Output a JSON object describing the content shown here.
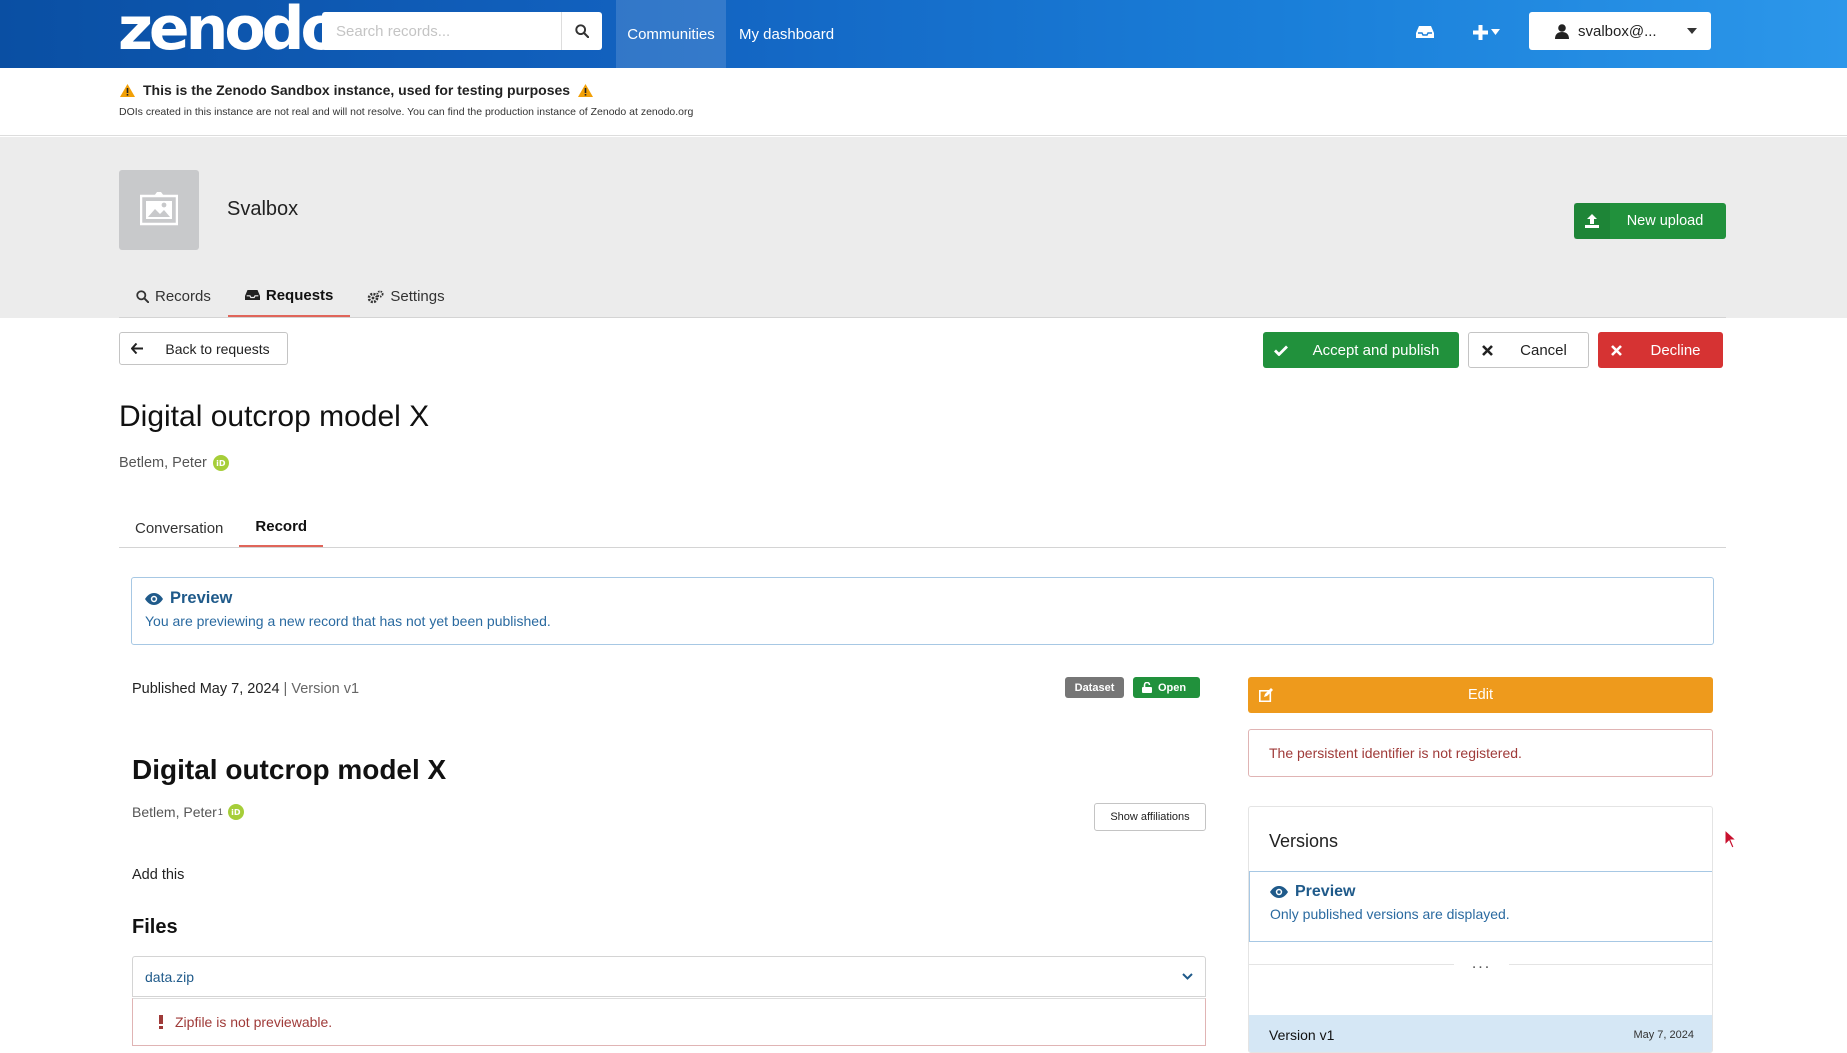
{
  "header": {
    "logo_text": "zenodo",
    "search_placeholder": "Search records...",
    "nav": [
      "Communities",
      "My dashboard"
    ],
    "user_label": "svalbox@...",
    "icons": [
      "search-icon",
      "inbox-icon",
      "plus-icon",
      "caret-down-icon",
      "user-icon"
    ]
  },
  "sandbox": {
    "title": "This is the Zenodo Sandbox instance, used for testing purposes",
    "subtitle": "DOIs created in this instance are not real and will not resolve. You can find the production instance of Zenodo at zenodo.org"
  },
  "community": {
    "name": "Svalbox",
    "new_upload_label": "New upload",
    "tabs": [
      {
        "label": "Records",
        "icon": "search-icon"
      },
      {
        "label": "Requests",
        "icon": "inbox-icon",
        "active": true
      },
      {
        "label": "Settings",
        "icon": "cogs-icon"
      }
    ]
  },
  "actions": {
    "back_label": "Back to requests",
    "accept_label": "Accept and publish",
    "cancel_label": "Cancel",
    "decline_label": "Decline"
  },
  "request": {
    "title": "Digital outcrop model X",
    "author": "Betlem, Peter",
    "tabs": [
      "Conversation",
      "Record"
    ],
    "active_tab": "Record"
  },
  "preview": {
    "heading": "Preview",
    "text": "You are previewing a new record that has not yet been published."
  },
  "record": {
    "published_label": "Published May 7, 2024",
    "version_label": "| Version v1",
    "badge_type": "Dataset",
    "badge_access": "Open",
    "title": "Digital outcrop model X",
    "author": "Betlem, Peter",
    "author_affiliation_marker": "1",
    "show_affiliations_label": "Show affiliations",
    "description": "Add this",
    "files_heading": "Files",
    "file_name": "data.zip",
    "file_error": "Zipfile is not previewable."
  },
  "sidebar": {
    "edit_label": "Edit",
    "pid_message": "The persistent identifier is not registered.",
    "versions_heading": "Versions",
    "versions_preview_heading": "Preview",
    "versions_preview_text": "Only published versions are displayed.",
    "ellipsis": "...",
    "version_name": "Version v1",
    "version_date": "May 7, 2024"
  },
  "colors": {
    "header_start": "#0a4fa3",
    "header_end": "#2c97ea",
    "green": "#21913c",
    "red": "#d63333",
    "orange": "#ee9a1c",
    "active_tab_underline": "#e0655a",
    "preview_blue": "#1f5a8a"
  }
}
